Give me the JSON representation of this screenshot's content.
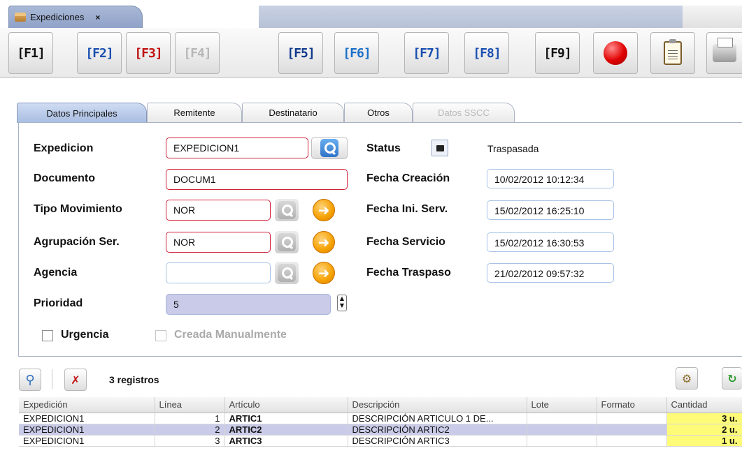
{
  "window_tab": {
    "title": "Expediciones",
    "close": "×"
  },
  "toolbar": {
    "buttons": [
      "[F1]",
      "[F2]",
      "[F3]",
      "[F4]",
      "[F5]",
      "[F6]",
      "[F7]",
      "[F8]",
      "[F9]"
    ]
  },
  "form_tabs": [
    "Datos Principales",
    "Remitente",
    "Destinatario",
    "Otros",
    "Datos SSCC"
  ],
  "form": {
    "expedicion": {
      "label": "Expedicion",
      "value": "EXPEDICION1"
    },
    "documento": {
      "label": "Documento",
      "value": "DOCUM1"
    },
    "tipo_movimiento": {
      "label": "Tipo Movimiento",
      "value": "NOR"
    },
    "agrupacion": {
      "label": "Agrupación Ser.",
      "value": "NOR"
    },
    "agencia": {
      "label": "Agencia",
      "value": ""
    },
    "prioridad": {
      "label": "Prioridad",
      "value": "5"
    },
    "status": {
      "label": "Status",
      "value": "Traspasada"
    },
    "fecha_creacion": {
      "label": "Fecha Creación",
      "value": "10/02/2012 10:12:34"
    },
    "fecha_ini_serv": {
      "label": "Fecha Ini. Serv.",
      "value": "15/02/2012 16:25:10"
    },
    "fecha_servicio": {
      "label": "Fecha Servicio",
      "value": "15/02/2012 16:30:53"
    },
    "fecha_traspaso": {
      "label": "Fecha Traspaso",
      "value": "21/02/2012 09:57:32"
    },
    "urgencia": {
      "label": "Urgencia",
      "checked": false
    },
    "creada_manualmente": {
      "label": "Creada Manualmente",
      "checked": false
    }
  },
  "grid": {
    "records": "3 registros",
    "columns": [
      "Expedición",
      "Línea",
      "Artículo",
      "Descripción",
      "Lote",
      "Formato",
      "Cantidad"
    ],
    "rows": [
      [
        "EXPEDICION1",
        "1",
        "ARTIC1",
        "DESCRIPCIÓN ARTICULO 1 DE...",
        "",
        "",
        "3 u."
      ],
      [
        "EXPEDICION1",
        "2",
        "ARTIC2",
        "DESCRIPCIÓN ARTIC2",
        "",
        "",
        "2 u."
      ],
      [
        "EXPEDICION1",
        "3",
        "ARTIC3",
        "DESCRIPCIÓN ARTIC3",
        "",
        "",
        "1 u."
      ]
    ]
  },
  "colors": {
    "accent": "#8fa2c8",
    "required_border": "#d0223a",
    "selected_row": "#c9cbe8",
    "qty_bg": "#fdfb78"
  }
}
